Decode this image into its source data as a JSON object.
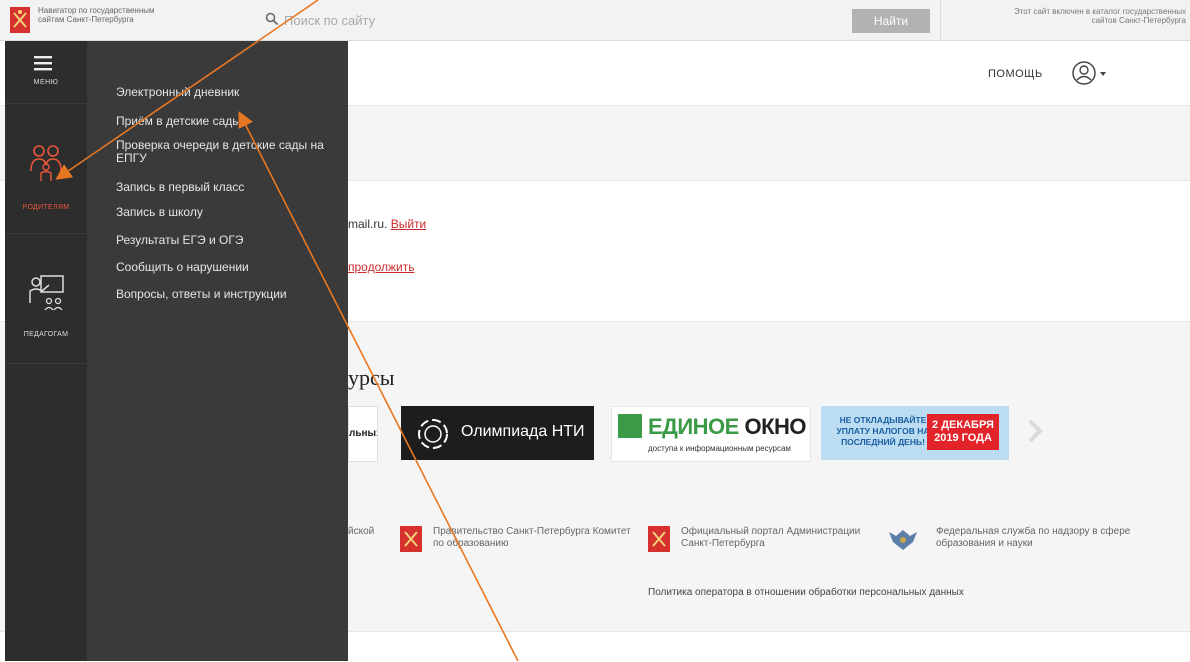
{
  "header": {
    "navigator_title": "Навигатор по государственным сайтам Санкт-Петербурга",
    "search_placeholder": "Поиск по сайту",
    "search_button": "Найти",
    "catalog_note": "Этот сайт включен в каталог государственных сайтов Санкт-Петербурга"
  },
  "topnav": {
    "help": "ПОМОЩЬ"
  },
  "content": {
    "email_fragment": "mail.ru.",
    "logout_link": "Выйти",
    "continue_link": "продолжить",
    "resources_heading_fragment": "урсы"
  },
  "banners": [
    {
      "text": "льных"
    },
    {
      "text": "Олимпиада НТИ"
    },
    {
      "title_a": "ЕДИНОЕ",
      "title_b": "ОКНО",
      "subtitle": "доступа к информационным ресурсам"
    },
    {
      "left": "НЕ ОТКЛАДЫВАЙТЕ УПЛАТУ НАЛОГОВ НА ПОСЛЕДНИЙ ДЕНЬ!",
      "right": "2 ДЕКАБРЯ 2019 ГОДА"
    }
  ],
  "footer": {
    "partners": [
      {
        "text": "йской"
      },
      {
        "text": "Правительство Санкт-Петербурга Комитет по образованию"
      },
      {
        "text": "Официальный портал Администрации Санкт-Петербурга"
      },
      {
        "text": "Федеральная служба по надзору в сфере образования и науки"
      }
    ],
    "policy": "Политика оператора в отношении обработки персональных данных"
  },
  "sidebar": {
    "menu_label": "МЕНЮ",
    "roles": [
      {
        "label": "РОДИТЕЛЯМ",
        "active": true,
        "color": "#e8563c"
      },
      {
        "label": "ПЕДАГОГАМ",
        "active": false,
        "color": "#dddddd"
      }
    ]
  },
  "submenu": {
    "items": [
      {
        "label": "Электронный дневник"
      },
      {
        "label": "Приём в детские сады"
      },
      {
        "label": "Проверка очереди в детские сады на ЕПГУ"
      },
      {
        "label": "Запись в первый класс"
      },
      {
        "label": "Запись в школу"
      },
      {
        "label": "Результаты ЕГЭ и ОГЭ"
      },
      {
        "label": "Сообщить о нарушении"
      },
      {
        "label": "Вопросы, ответы и инструкции"
      }
    ]
  },
  "colors": {
    "accent": "#e8563c",
    "link": "#cc2a2a",
    "annotation": "#e87722",
    "sidebar": "#2d2d2d",
    "submenu": "#3a3a3a"
  }
}
